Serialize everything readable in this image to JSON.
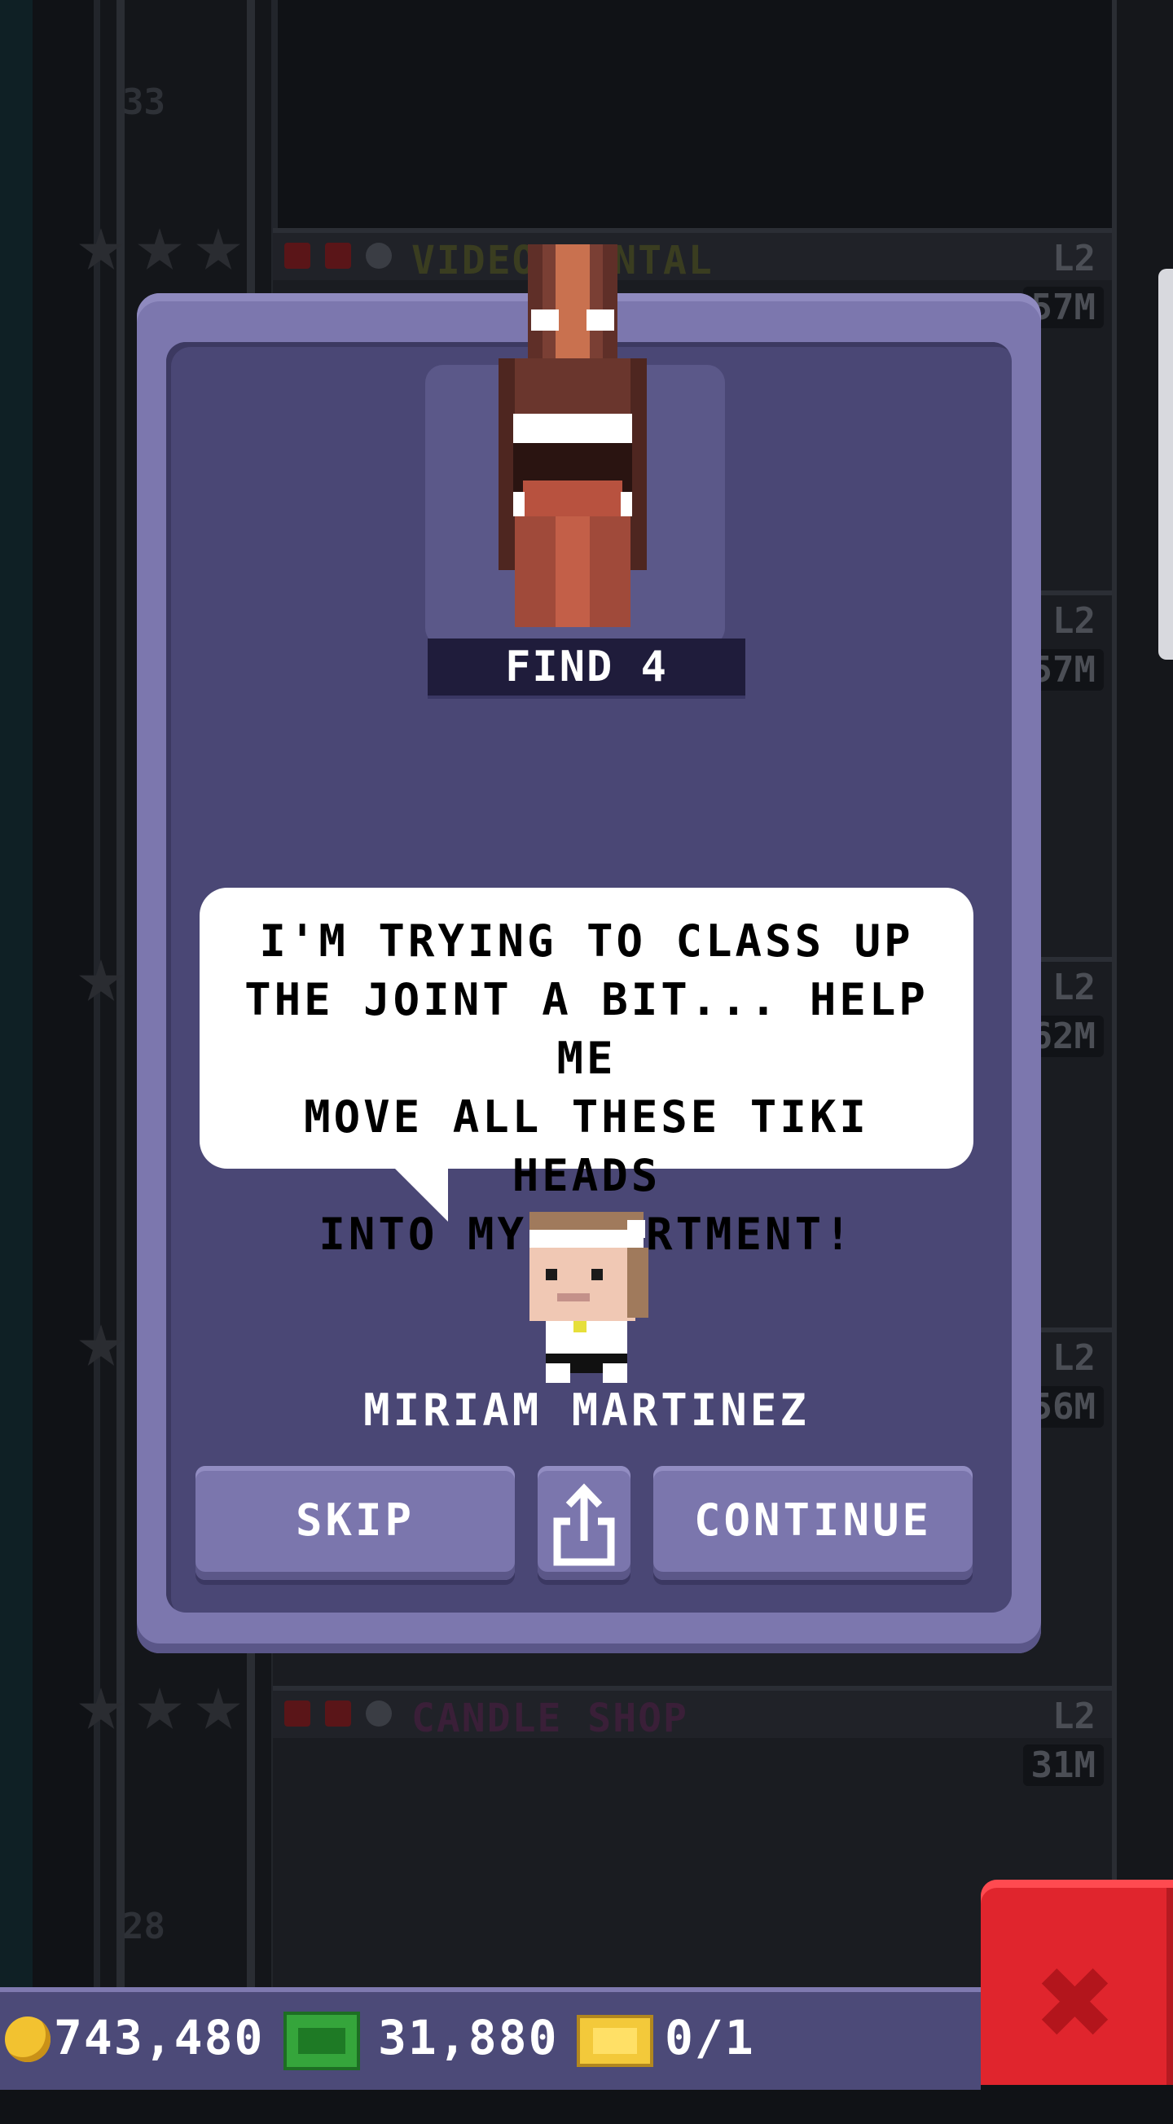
{
  "background": {
    "floors": [
      {
        "name": "VIDEO RENTAL",
        "level": "L2",
        "income": "57M",
        "name_color": "#3a3d20"
      },
      {
        "name": "",
        "level": "L2",
        "income": "57M"
      },
      {
        "name": "",
        "level": "L2",
        "income": "62M"
      },
      {
        "name": "",
        "level": "L2",
        "income": "56M"
      },
      {
        "name": "CANDLE SHOP",
        "level": "L2",
        "income": "31M",
        "name_color": "#3a1f38"
      }
    ],
    "floor_numbers": [
      "33",
      "28"
    ]
  },
  "dialog": {
    "reward_label": "FIND 4",
    "speech": "I'M TRYING TO CLASS UP\nTHE JOINT A BIT... HELP ME\nMOVE ALL THESE TIKI HEADS\nINTO MY APARTMENT!",
    "character_name": "MIRIAM MARTINEZ",
    "buttons": {
      "skip": "SKIP",
      "share_icon": "share-icon",
      "continue": "CONTINUE"
    }
  },
  "hud": {
    "coins": "743,480",
    "bux": "31,880",
    "tickets": "0/1"
  },
  "colors": {
    "dialog": "#7c77ae",
    "dialog_inner": "#4a4775",
    "close_button": "#e0252d"
  }
}
